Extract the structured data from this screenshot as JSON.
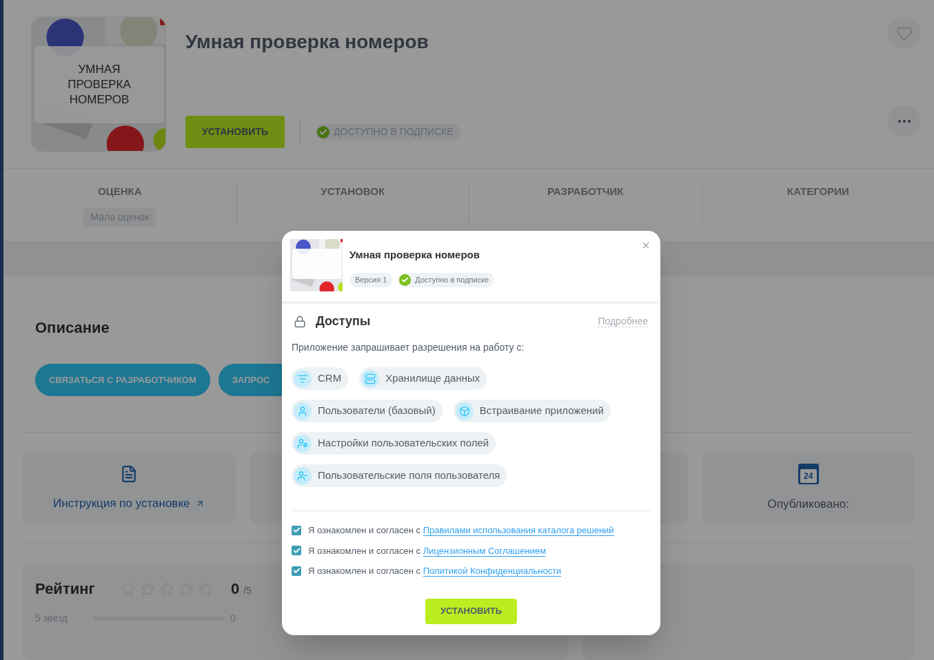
{
  "app": {
    "icon_caption": "УМНАЯ ПРОВЕРКА НОМЕРОВ",
    "title": "Умная проверка номеров",
    "install_button": "УСТАНОВИТЬ",
    "subscription_badge": "ДОСТУПНО В ПОДПИСКЕ"
  },
  "stats": [
    {
      "label": "ОЦЕНКА",
      "badge": "Мало оценок"
    },
    {
      "label": "УСТАНОВОК"
    },
    {
      "label": "РАЗРАБОТЧИК"
    },
    {
      "label": "КАТЕГОРИИ"
    }
  ],
  "description": {
    "heading": "Описание",
    "buttons": [
      "СВЯЗАТЬСЯ С РАЗРАБОТЧИКОМ",
      "ЗАПРОС"
    ]
  },
  "info_cards": [
    {
      "kind": "instruction",
      "label": "Инструкция по установке"
    },
    {
      "kind": "empty"
    },
    {
      "kind": "empty"
    },
    {
      "kind": "published",
      "label": "Опубликовано:",
      "day": "24"
    }
  ],
  "rating": {
    "heading": "Рейтинг",
    "stars": 0,
    "score": "0",
    "out_of": "/5",
    "rows": [
      {
        "label": "5 звезд",
        "level": 0,
        "count": "0"
      }
    ]
  },
  "dialog": {
    "title": "Умная проверка номеров",
    "version": "Версия 1",
    "subscription": "Доступно в подписке",
    "close": "×",
    "access_heading": "Доступы",
    "more_link": "Подробнее",
    "intro": "Приложение запрашивает разрешения на работу с:",
    "permissions": [
      {
        "kind": "crm",
        "label": "CRM"
      },
      {
        "kind": "storage",
        "label": "Хранилище данных"
      },
      {
        "kind": "user",
        "label": "Пользователи (базовый)"
      },
      {
        "kind": "embed",
        "label": "Встраивание приложений"
      },
      {
        "kind": "user_settings",
        "label": "Настройки пользовательских полей"
      },
      {
        "kind": "user_fields",
        "label": "Пользовательские поля пользователя"
      }
    ],
    "agreements": [
      {
        "text": "Я ознакомлен и согласен с",
        "link": "Правилами использования каталога решений",
        "checked": true
      },
      {
        "text": "Я ознакомлен и согласен с",
        "link": "Лицензионным Соглашением",
        "checked": true
      },
      {
        "text": "Я ознакомлен и согласен с",
        "link": "Политикой Конфиденциальности",
        "checked": true
      }
    ],
    "install_button": "УСТАНОВИТЬ"
  }
}
